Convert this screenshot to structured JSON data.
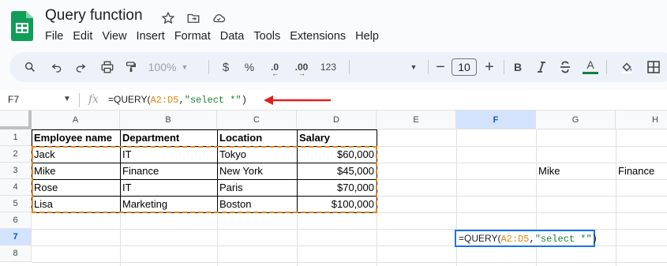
{
  "app": {
    "doc_title": "Query function",
    "logo_icon": "google-sheets-logo",
    "title_icons": [
      "star-icon",
      "move-to-folder-icon",
      "cloud-saved-icon"
    ]
  },
  "menu": [
    "File",
    "Edit",
    "View",
    "Insert",
    "Format",
    "Data",
    "Tools",
    "Extensions",
    "Help"
  ],
  "toolbar": {
    "zoom": "100%",
    "currency": "$",
    "percent": "%",
    "decrease_decimal": ".0",
    "more_formats": "123",
    "font_size": "10",
    "bold": "B",
    "text_color_letter": "A",
    "text_color_accent": "#188038"
  },
  "formula_bar": {
    "name_box": "F7",
    "fx": "fx",
    "formula_parts": {
      "prefix": "=QUERY(",
      "range": "A2:D5",
      "comma": ",",
      "string": "\"select *\"",
      "close": ")"
    },
    "arrow_color": "#e02020"
  },
  "grid": {
    "columns": [
      "A",
      "B",
      "C",
      "D",
      "E",
      "F",
      "G",
      "H"
    ],
    "rows": [
      "1",
      "2",
      "3",
      "4",
      "5",
      "6",
      "7",
      "8"
    ],
    "selected_column": "F",
    "selected_row": "7",
    "header": [
      "Employee name",
      "Department",
      "Location",
      "Salary"
    ],
    "data": [
      [
        "Jack",
        "IT",
        "Tokyo",
        "$60,000"
      ],
      [
        "Mike",
        "Finance",
        "New York",
        "$45,000"
      ],
      [
        "Rose",
        "IT",
        "Paris",
        "$70,000"
      ],
      [
        "Lisa",
        "Marketing",
        "Boston",
        "$100,000"
      ]
    ],
    "spill_row3": {
      "G": "Mike",
      "H": "Finance"
    },
    "active_cell_formula": {
      "prefix": "=QUERY(",
      "range": "A2:D5",
      "comma": ",",
      "string": "\"select *\"",
      "close": ")"
    }
  },
  "colors": {
    "accent_blue": "#1a73e8",
    "range_orange": "#e8850b",
    "string_green": "#188038",
    "sheets_green": "#0f9d58"
  }
}
